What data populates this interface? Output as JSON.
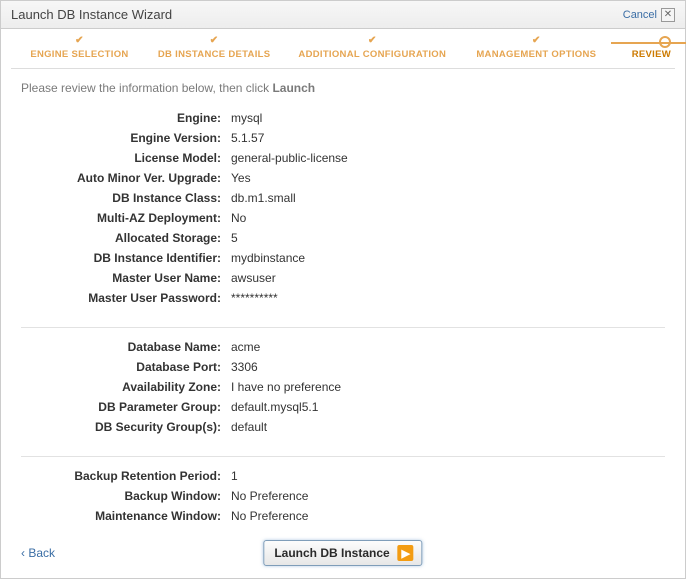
{
  "header": {
    "title": "Launch DB Instance Wizard",
    "cancel_label": "Cancel"
  },
  "steps": [
    {
      "label": "ENGINE SELECTION",
      "done": true
    },
    {
      "label": "DB INSTANCE DETAILS",
      "done": true
    },
    {
      "label": "ADDITIONAL CONFIGURATION",
      "done": true
    },
    {
      "label": "MANAGEMENT OPTIONS",
      "done": true
    },
    {
      "label": "REVIEW",
      "active": true
    }
  ],
  "instruction_prefix": "Please review the information below, then click ",
  "instruction_action": "Launch",
  "review": {
    "section1": [
      {
        "label": "Engine:",
        "value": "mysql"
      },
      {
        "label": "Engine Version:",
        "value": "5.1.57"
      },
      {
        "label": "License Model:",
        "value": "general-public-license"
      },
      {
        "label": "Auto Minor Ver. Upgrade:",
        "value": "Yes"
      },
      {
        "label": "DB Instance Class:",
        "value": "db.m1.small"
      },
      {
        "label": "Multi-AZ Deployment:",
        "value": "No"
      },
      {
        "label": "Allocated Storage:",
        "value": "5"
      },
      {
        "label": "DB Instance Identifier:",
        "value": "mydbinstance"
      },
      {
        "label": "Master User Name:",
        "value": "awsuser"
      },
      {
        "label": "Master User Password:",
        "value": "**********"
      }
    ],
    "section2": [
      {
        "label": "Database Name:",
        "value": "acme"
      },
      {
        "label": "Database Port:",
        "value": "3306"
      },
      {
        "label": "Availability Zone:",
        "value": "I have no preference"
      },
      {
        "label": "DB Parameter Group:",
        "value": "default.mysql5.1"
      },
      {
        "label": "DB Security Group(s):",
        "value": "default"
      }
    ],
    "section3": [
      {
        "label": "Backup Retention Period:",
        "value": "1"
      },
      {
        "label": "Backup Window:",
        "value": "No Preference"
      },
      {
        "label": "Maintenance Window:",
        "value": "No Preference"
      }
    ]
  },
  "footer": {
    "back_label": "Back",
    "launch_label": "Launch DB Instance"
  }
}
